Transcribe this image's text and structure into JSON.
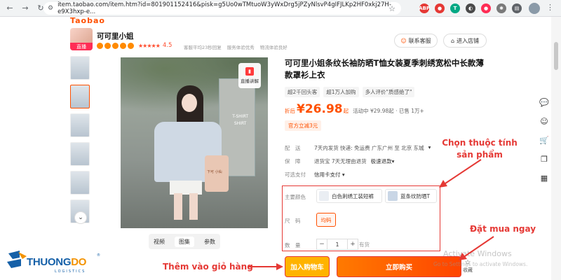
{
  "browser": {
    "url": "item.taobao.com/item.htm?id=801901152416&pisk=g5Uo0wTMtuoW3yWxDrg5jPZyNlsvP4gIFJLKp2HF0xkj27H-e9X3hxp-e..."
  },
  "header": {
    "logo_text": "Taobao",
    "shop_name": "可可里小姐",
    "live_tag": "直播",
    "rating": "4.5",
    "shop_notes": [
      "客服平均23秒回复",
      "服务体验优秀",
      "物流体验良好"
    ],
    "contact_label": "联系客服",
    "enter_shop_label": "进入店铺"
  },
  "gallery": {
    "live_explain": "直播讲解",
    "wall_text": "T-SHIRT\nSHIRT",
    "bag_text": "下可 小仙",
    "tabs": [
      "视频",
      "图集",
      "参数"
    ],
    "active_tab": "图集"
  },
  "product": {
    "title": "可可里小姐条纹长袖防晒T恤女装夏季刺绣宽松中长款薄款罩衫上衣",
    "tags": [
      "超2千回头客",
      "超1万人加购",
      "多人评价\"质感绝了\""
    ],
    "price_label": "折后",
    "price": "¥26.98",
    "price_suffix": "起",
    "price_note": "活动中 ¥29.98起 · 已售 1万+",
    "coupon": "官方立减3元",
    "shipping": {
      "label": "配　送",
      "text": "7天内发货  快递: 免运费  广东广州  至  北京 东城",
      "dropdown": "▾"
    },
    "guarantee": {
      "label": "保　障",
      "text": "退货宝   7天无理由退货",
      "dropdown": "极速退款▾"
    },
    "payment": {
      "label": "可选支付",
      "text": "信用卡支付 ▾"
    },
    "color_label": "主要颜色",
    "colors": [
      "白色刺绣工装短裤",
      "蓝条纹防晒T"
    ],
    "size_label": "尺　码",
    "sizes": [
      "均码"
    ],
    "qty_label": "数　量",
    "qty": "1",
    "stock": "有货",
    "add_cart": "加入购物车",
    "buy_now": "立即购买",
    "favorite": "收藏"
  },
  "annotations": {
    "select_attrs": "Chọn thuộc tính\nsản phẩm",
    "buy_now": "Đặt mua ngay",
    "add_cart": "Thêm vào giỏ hàng"
  },
  "watermark": {
    "line1": "Activate Windows",
    "line2": "Go to Settings to activate Windows."
  },
  "logo": {
    "brand_a": "THUONG",
    "brand_b": "DO",
    "sub": "LOGISTICS",
    "reg": "®"
  },
  "colors": {
    "accent": "#ff5000",
    "annotation_red": "#e53935",
    "cart_yellow": "#ffb300"
  }
}
